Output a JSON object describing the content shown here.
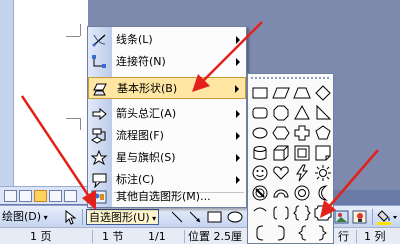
{
  "menu": {
    "items": [
      {
        "label": "线条(L)",
        "icon": "lines-icon",
        "submenu": true
      },
      {
        "label": "连接符(N)",
        "icon": "connectors-icon",
        "submenu": true
      },
      {
        "label": "基本形状(B)",
        "icon": "basic-shapes-icon",
        "submenu": true
      },
      {
        "label": "箭头总汇(A)",
        "icon": "block-arrows-icon",
        "submenu": true
      },
      {
        "label": "流程图(F)",
        "icon": "flowchart-icon",
        "submenu": true
      },
      {
        "label": "星与旗帜(S)",
        "icon": "stars-banners-icon",
        "submenu": true
      },
      {
        "label": "标注(C)",
        "icon": "callouts-icon",
        "submenu": true
      },
      {
        "label": "其他自选图形(M)...",
        "icon": "more-autoshapes-icon",
        "submenu": false
      }
    ]
  },
  "toolbar": {
    "draw_label": "绘图(D)",
    "autoshapes_label": "自选图形(U)"
  },
  "status": {
    "page": "1 页",
    "section": "1 节",
    "page_of": "1/1",
    "position": "位置 2.5厘",
    "line": "行",
    "column": "1 列"
  },
  "colors": {
    "highlight": "#ffe7a3",
    "arrow": "#e3211c",
    "menu_strip": "#bccbe9",
    "toolbar": "#c5d4f0"
  }
}
